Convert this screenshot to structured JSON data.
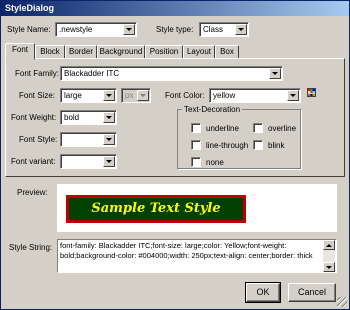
{
  "window": {
    "title": "StyleDialog"
  },
  "header": {
    "style_name_label": "Style Name:",
    "style_name_value": ".newstyle",
    "style_type_label": "Style type:",
    "style_type_value": "Class"
  },
  "tabs": [
    "Font",
    "Block",
    "Border",
    "Background",
    "Position",
    "Layout",
    "Box"
  ],
  "active_tab": "Font",
  "font": {
    "family_label": "Font Family:",
    "family_value": "Blackadder ITC",
    "size_label": "Font Size:",
    "size_value": "large",
    "size_unit": "px",
    "color_label": "Font Color:",
    "color_value": "yellow",
    "weight_label": "Font Weight:",
    "weight_value": "bold",
    "style_label": "Font Style:",
    "style_value": "",
    "variant_label": "Font variant:",
    "variant_value": ""
  },
  "decoration": {
    "label": "Text-Decoration",
    "options": [
      "underline",
      "overline",
      "line-through",
      "blink",
      "none"
    ]
  },
  "preview": {
    "label": "Preview:",
    "sample_text": "Sample Text Style",
    "colors": {
      "text": "#ffff00",
      "background": "#004000",
      "border": "#c00000"
    }
  },
  "style_string": {
    "label": "Style String:",
    "value": "font-family: Blackadder ITC;font-size: large;color: Yellow;font-weight: bold;background-color: #004000;width: 250px;text-align: center;border: thick"
  },
  "buttons": {
    "ok": "OK",
    "cancel": "Cancel"
  }
}
